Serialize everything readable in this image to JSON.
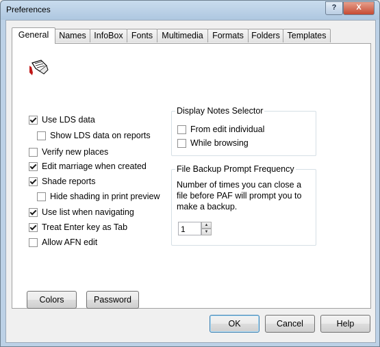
{
  "window": {
    "title": "Preferences",
    "help_glyph": "?",
    "close_glyph": "X"
  },
  "tabs": [
    "General",
    "Names",
    "InfoBox",
    "Fonts",
    "Multimedia",
    "Formats",
    "Folders",
    "Templates"
  ],
  "active_tab": "General",
  "general": {
    "options": [
      {
        "label": "Use LDS data",
        "checked": true
      },
      {
        "label": "Show LDS data on reports",
        "checked": false
      },
      {
        "label": "Verify new places",
        "checked": false
      },
      {
        "label": "Edit marriage when created",
        "checked": true
      },
      {
        "label": "Shade reports",
        "checked": true
      },
      {
        "label": "Hide shading in print preview",
        "checked": false
      },
      {
        "label": "Use list when navigating",
        "checked": true
      },
      {
        "label": "Treat Enter key as Tab",
        "checked": true
      },
      {
        "label": "Allow AFN edit",
        "checked": false
      }
    ],
    "notes_selector": {
      "title": "Display Notes Selector",
      "options": [
        {
          "label": "From edit individual",
          "checked": false
        },
        {
          "label": "While browsing",
          "checked": false
        }
      ]
    },
    "backup": {
      "title": "File Backup Prompt Frequency",
      "description": "Number of times you can close a file before PAF will prompt you to make a backup.",
      "value": "1"
    },
    "colors_label": "Colors",
    "password_label": "Password"
  },
  "footer": {
    "ok_label": "OK",
    "cancel_label": "Cancel",
    "help_label": "Help"
  }
}
